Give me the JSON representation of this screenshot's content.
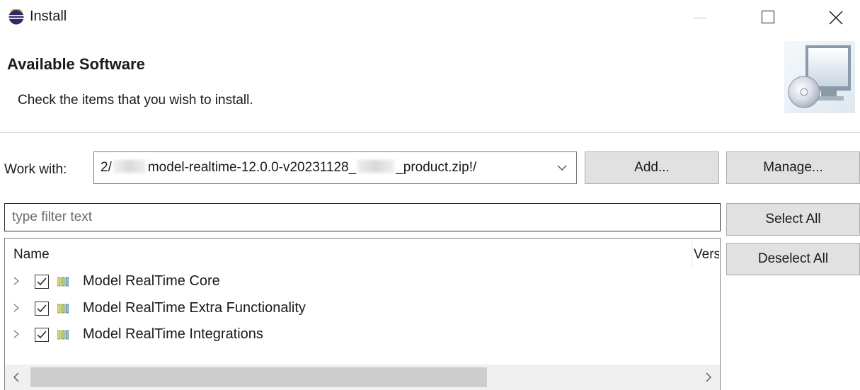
{
  "window": {
    "title": "Install",
    "controls": {
      "minimize_icon": "minimize-icon",
      "maximize_icon": "maximize-icon",
      "close_icon": "close-icon"
    }
  },
  "header": {
    "title": "Available Software",
    "description": "Check the items that you wish to install.",
    "banner_icon": "install-software-banner-icon"
  },
  "work_with": {
    "label": "Work with:",
    "value_prefix": "2/",
    "value_middle": "model-realtime-12.0.0-v20231128_",
    "value_suffix": "_product.zip!/",
    "add_label": "Add...",
    "manage_label": "Manage..."
  },
  "filter": {
    "placeholder": "type filter text"
  },
  "buttons": {
    "select_all": "Select All",
    "deselect_all": "Deselect All"
  },
  "tree": {
    "columns": [
      "Name",
      "Version"
    ],
    "items": [
      {
        "label": "Model RealTime Core",
        "checked": true,
        "expanded": false
      },
      {
        "label": "Model RealTime Extra Functionality",
        "checked": true,
        "expanded": false
      },
      {
        "label": "Model RealTime Integrations",
        "checked": true,
        "expanded": false
      }
    ]
  },
  "colors": {
    "button_bg": "#e1e1e1",
    "scroll_thumb": "#cdcdcd",
    "app_icon_blue": "#2c2a6b"
  }
}
